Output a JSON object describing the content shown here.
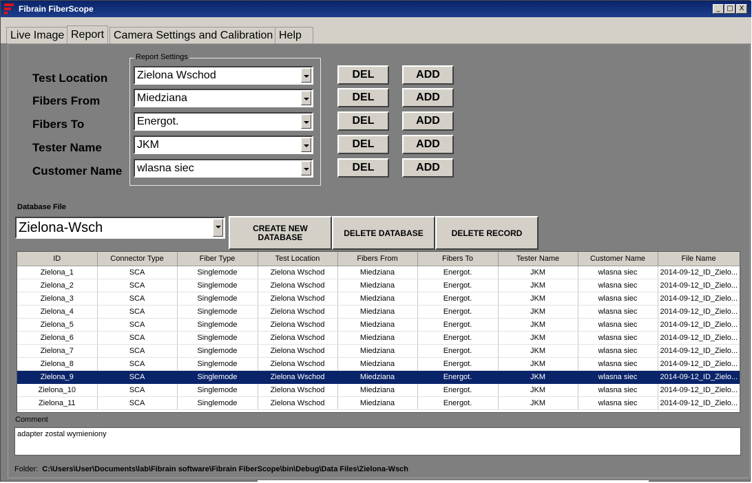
{
  "window": {
    "title": "Fibrain FiberScope",
    "controls": [
      "_",
      "□",
      "X"
    ]
  },
  "tabs": [
    "Live Image",
    "Report",
    "Camera Settings and Calibration",
    "Help"
  ],
  "active_tab": "Report",
  "report_settings": {
    "group_title": "Report Settings",
    "rows": [
      {
        "label": "Test Location",
        "value": "Zielona Wschod"
      },
      {
        "label": "Fibers From",
        "value": "Miedziana"
      },
      {
        "label": "Fibers To",
        "value": "Energot."
      },
      {
        "label": "Tester Name",
        "value": "JKM"
      },
      {
        "label": "Customer Name",
        "value": "wlasna siec"
      }
    ],
    "del_label": "DEL",
    "add_label": "ADD"
  },
  "database": {
    "label": "Database File",
    "value": "Zielona-Wsch",
    "create_label": "CREATE NEW DATABASE",
    "delete_db_label": "DELETE DATABASE",
    "delete_record_label": "DELETE RECORD"
  },
  "table": {
    "columns": [
      "ID",
      "Connector Type",
      "Fiber Type",
      "Test Location",
      "Fibers From",
      "Fibers To",
      "Tester Name",
      "Customer Name",
      "File Name"
    ],
    "rows": [
      [
        "Zielona_1",
        "SCA",
        "Singlemode",
        "Zielona Wschod",
        "Miedziana",
        "Energot.",
        "JKM",
        "wlasna siec",
        "2014-09-12_ID_Zielo..."
      ],
      [
        "Zielona_2",
        "SCA",
        "Singlemode",
        "Zielona Wschod",
        "Miedziana",
        "Energot.",
        "JKM",
        "wlasna siec",
        "2014-09-12_ID_Zielo..."
      ],
      [
        "Zielona_3",
        "SCA",
        "Singlemode",
        "Zielona Wschod",
        "Miedziana",
        "Energot.",
        "JKM",
        "wlasna siec",
        "2014-09-12_ID_Zielo..."
      ],
      [
        "Zielona_4",
        "SCA",
        "Singlemode",
        "Zielona Wschod",
        "Miedziana",
        "Energot.",
        "JKM",
        "wlasna siec",
        "2014-09-12_ID_Zielo..."
      ],
      [
        "Zielona_5",
        "SCA",
        "Singlemode",
        "Zielona Wschod",
        "Miedziana",
        "Energot.",
        "JKM",
        "wlasna siec",
        "2014-09-12_ID_Zielo..."
      ],
      [
        "Zielona_6",
        "SCA",
        "Singlemode",
        "Zielona Wschod",
        "Miedziana",
        "Energot.",
        "JKM",
        "wlasna siec",
        "2014-09-12_ID_Zielo..."
      ],
      [
        "Zielona_7",
        "SCA",
        "Singlemode",
        "Zielona Wschod",
        "Miedziana",
        "Energot.",
        "JKM",
        "wlasna siec",
        "2014-09-12_ID_Zielo..."
      ],
      [
        "Zielona_8",
        "SCA",
        "Singlemode",
        "Zielona Wschod",
        "Miedziana",
        "Energot.",
        "JKM",
        "wlasna siec",
        "2014-09-12_ID_Zielo..."
      ],
      [
        "Zielona_9",
        "SCA",
        "Singlemode",
        "Zielona Wschod",
        "Miedziana",
        "Energot.",
        "JKM",
        "wlasna siec",
        "2014-09-12_ID_Zielo..."
      ],
      [
        "Zielona_10",
        "SCA",
        "Singlemode",
        "Zielona Wschod",
        "Miedziana",
        "Energot.",
        "JKM",
        "wlasna siec",
        "2014-09-12_ID_Zielo..."
      ],
      [
        "Zielona_11",
        "SCA",
        "Singlemode",
        "Zielona Wschod",
        "Miedziana",
        "Energot.",
        "JKM",
        "wlasna siec",
        "2014-09-12_ID_Zielo..."
      ]
    ],
    "selected_row_index": 8
  },
  "comment": {
    "label": "Comment",
    "value": "adapter zostal wymieniony"
  },
  "folder": {
    "label": "Folder:",
    "path": "C:\\Users\\User\\Documents\\lab\\Fibrain software\\Fibrain FiberScope\\bin\\Debug\\Data Files\\Zielona-Wsch"
  },
  "colors": {
    "selection": "#0a246a",
    "panel": "#7f7f7f",
    "control_face": "#d4d0c8",
    "brand": "#d8141c"
  }
}
